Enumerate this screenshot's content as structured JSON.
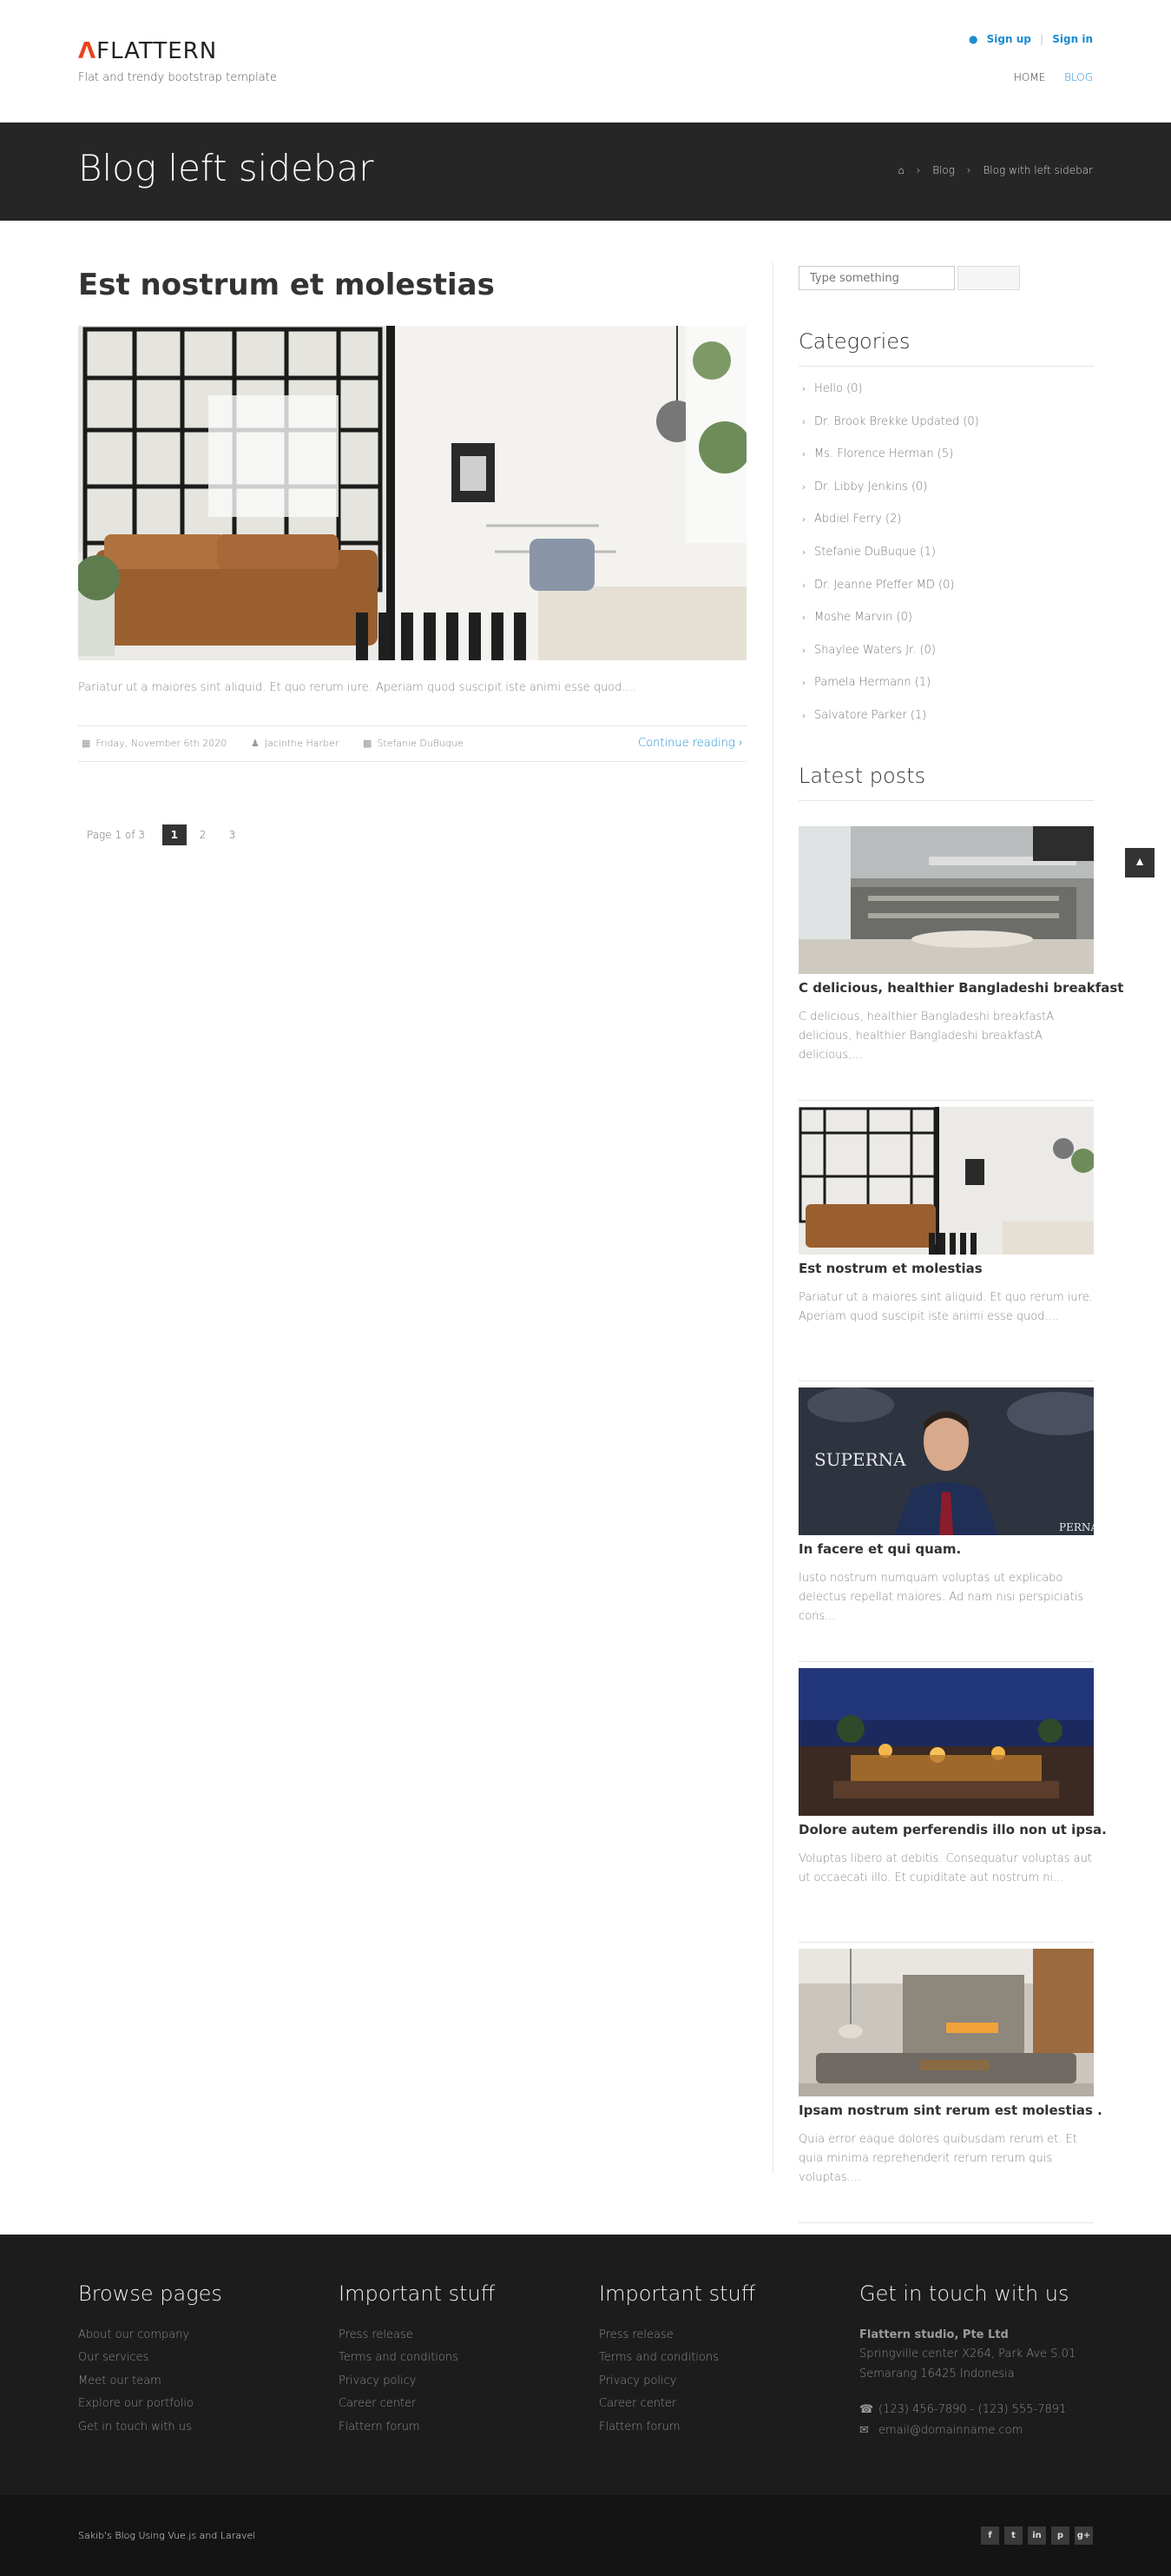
{
  "header": {
    "logo_mark": "Λ",
    "logo_text": "FLATTERN",
    "tagline": "Flat and trendy bootstrap template",
    "sign_up": "Sign up",
    "separator": "|",
    "sign_in": "Sign in",
    "nav": [
      "HOME",
      "BLOG"
    ],
    "active_nav": "BLOG"
  },
  "title_bar": {
    "title": "Blog left sidebar",
    "breadcrumb": [
      "Blog",
      "Blog with left sidebar"
    ]
  },
  "post": {
    "title": "Est nostrum et molestias",
    "excerpt": "Pariatur ut a maiores sint aliquid. Et quo rerum iure. Aperiam quod suscipit iste animi esse quod....",
    "date": "Friday, November 6th 2020",
    "author": "Jacinthe Harber",
    "category": "Stefanie DuBuque",
    "continue": "Continue reading"
  },
  "pagination": {
    "info": "Page 1 of 3",
    "pages": [
      "1",
      "2",
      "3"
    ],
    "current": "1"
  },
  "sidebar": {
    "search_placeholder": "Type something",
    "categories_title": "Categories",
    "categories": [
      "Hello (0)",
      "Dr. Brook Brekke Updated (0)",
      "Ms. Florence Herman (5)",
      "Dr. Libby Jenkins (0)",
      "Abdiel Ferry (2)",
      "Stefanie DuBuque (1)",
      "Dr. Jeanne Pfeffer MD (0)",
      "Moshe Marvin (0)",
      "Shaylee Waters Jr. (0)",
      "Pamela Hermann (1)",
      "Salvatore Parker (1)"
    ],
    "latest_title": "Latest posts",
    "latest_posts": [
      {
        "title": "C delicious, healthier Bangladeshi breakfast",
        "text": "C delicious, healthier Bangladeshi breakfastA delicious, healthier Bangladeshi breakfastA delicious,..."
      },
      {
        "title": "Est nostrum et molestias",
        "text": "Pariatur ut a maiores sint aliquid. Et quo rerum iure. Aperiam quod suscipit iste animi esse quod...."
      },
      {
        "title": "In facere et qui quam.",
        "text": "Iusto nostrum numquam voluptas ut explicabo delectus repellat maiores. Ad nam nisi perspiciatis cons..."
      },
      {
        "title": "Dolore autem perferendis illo non ut ipsa.",
        "text": "Voluptas libero at debitis. Consequatur voluptas aut ut occaecati illo. Et cupiditate aut nostrum ni..."
      },
      {
        "title": "Ipsam nostrum sint rerum est molestias .",
        "text": "Quia error eaque dolores quibusdam rerum et. Et quia minima reprehenderit rerum rerum quis voluptas...."
      }
    ]
  },
  "footer": {
    "col1_title": "Browse pages",
    "col1_links": [
      "About our company",
      "Our services",
      "Meet our team",
      "Explore our portfolio",
      "Get in touch with us"
    ],
    "col2_title": "Important stuff",
    "col2_links": [
      "Press release",
      "Terms and conditions",
      "Privacy policy",
      "Career center",
      "Flattern forum"
    ],
    "col3_title": "Important stuff",
    "col3_links": [
      "Press release",
      "Terms and conditions",
      "Privacy policy",
      "Career center",
      "Flattern forum"
    ],
    "col4_title": "Get in touch with us",
    "company": "Flattern studio, Pte Ltd",
    "address1": "Springville center X264, Park Ave S.01",
    "address2": "Semarang 16425 Indonesia",
    "phone": "(123) 456-7890 - (123) 555-7891",
    "email": "email@domainname.com",
    "copyright": "Sakib's Blog Using Vue.js and Laravel",
    "social": [
      "f",
      "t",
      "in",
      "p",
      "g+"
    ]
  },
  "colors": {
    "accent": "#1a8bd1",
    "logo_accent": "#e8441b",
    "title_bar_bg": "#262626",
    "footer_bg": "#1c1c1c",
    "subfooter_bg": "#141414"
  }
}
